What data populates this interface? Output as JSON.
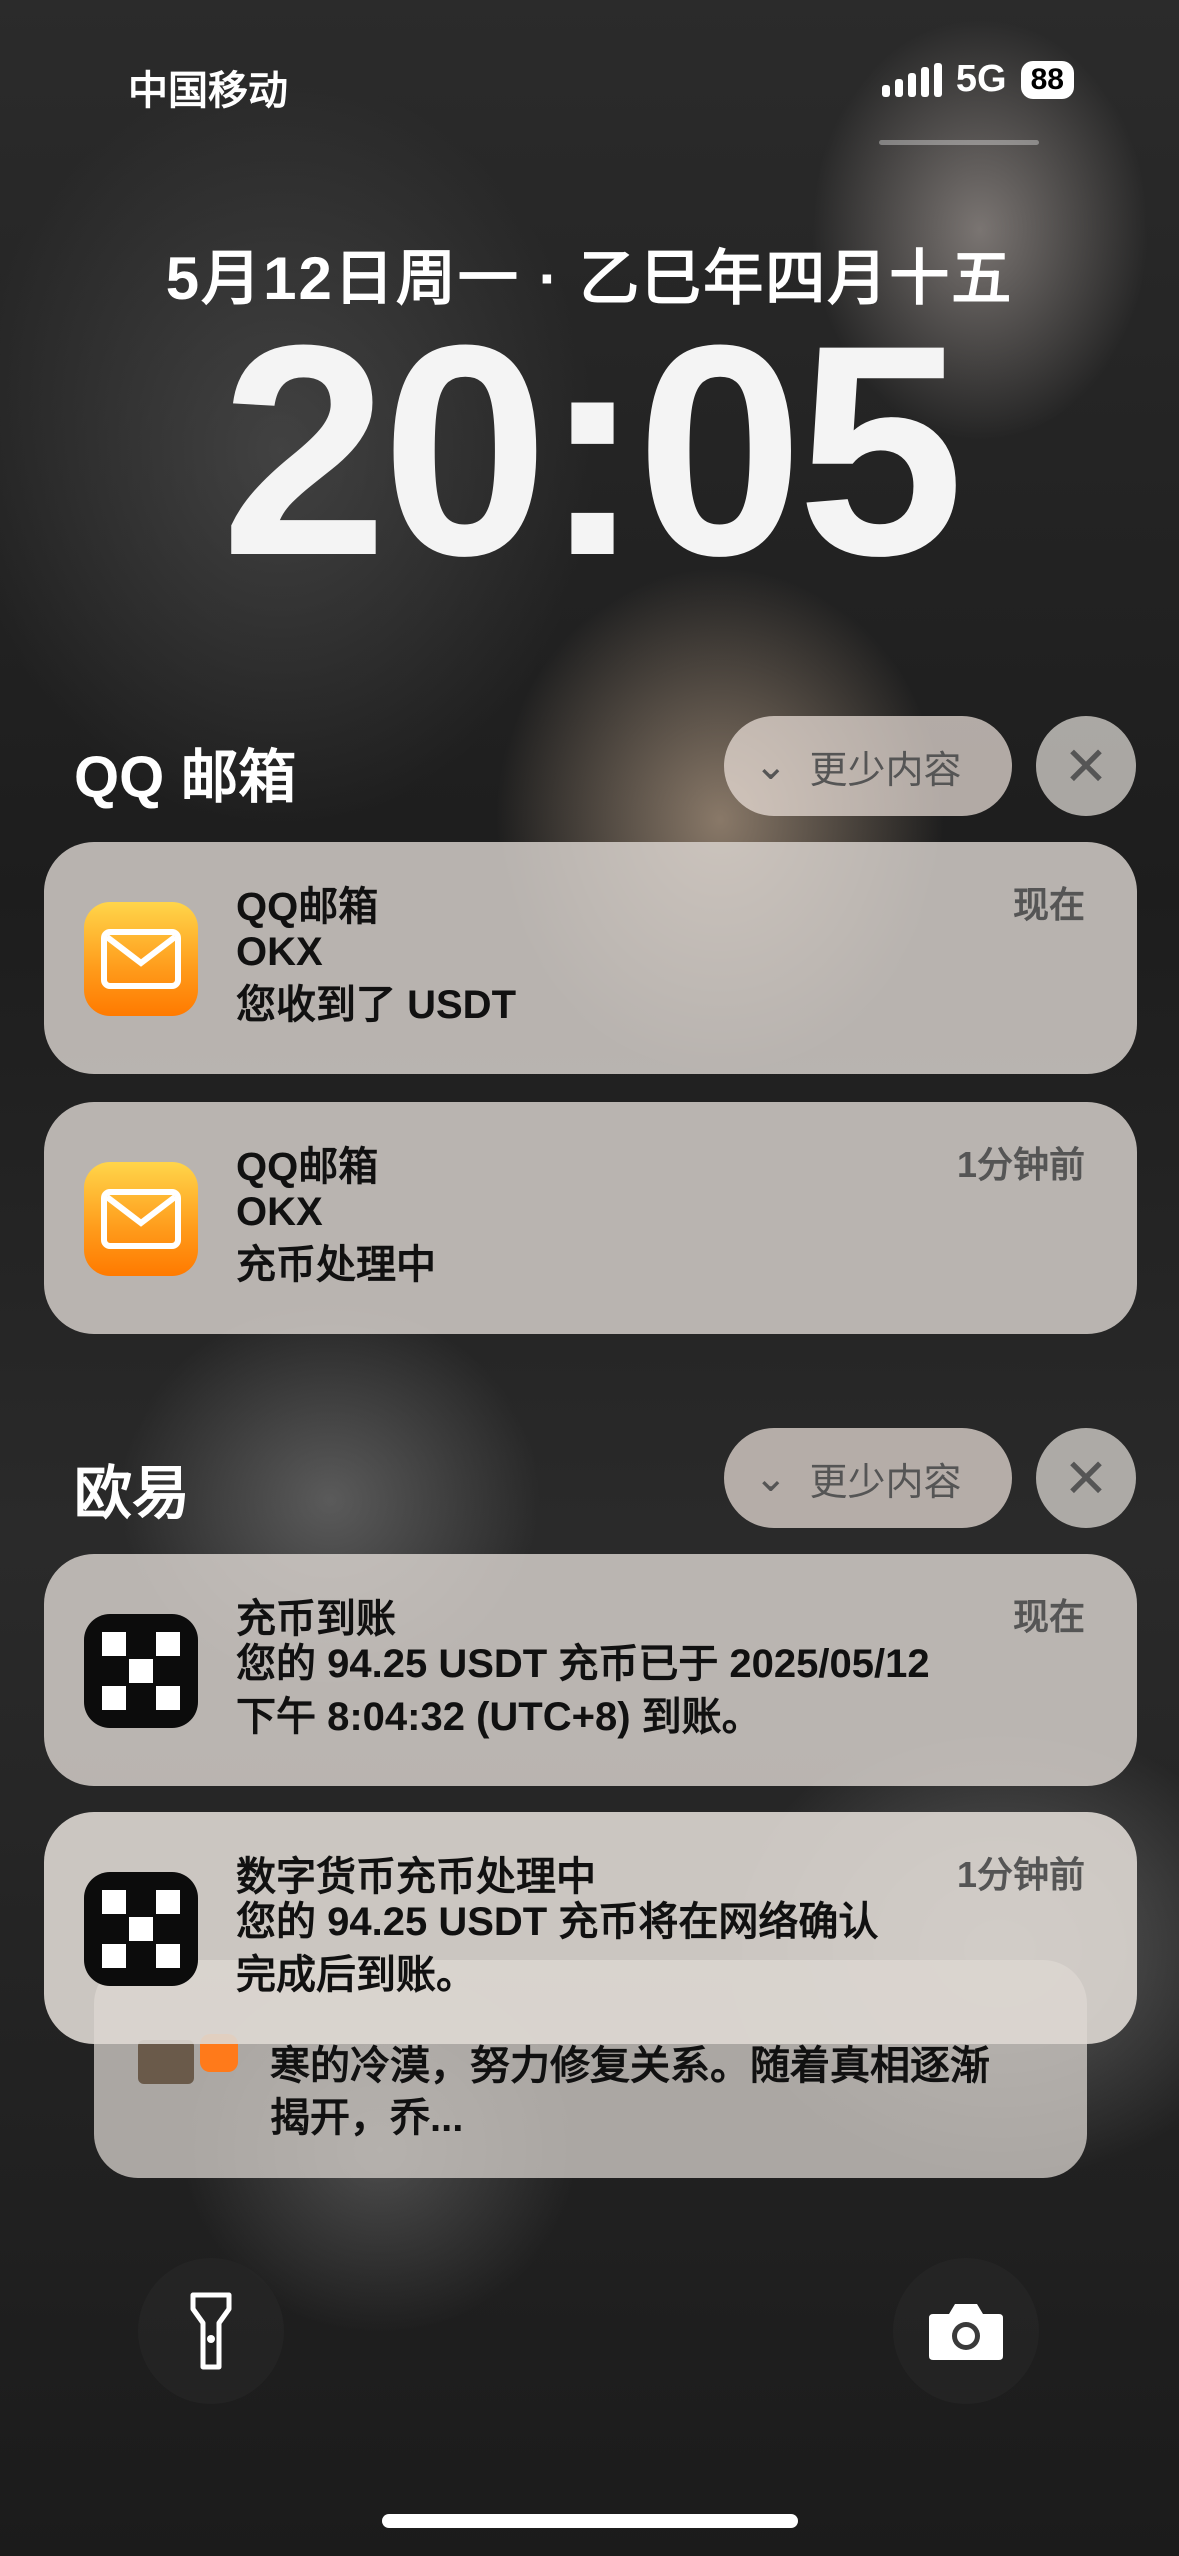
{
  "status_bar": {
    "carrier": "中国移动",
    "network": "5G",
    "battery": "88"
  },
  "lock_screen": {
    "date": "5月12日周一 · 乙巳年四月十五",
    "time": "20:05"
  },
  "groups": [
    {
      "app": "QQ 邮箱",
      "collapse_label": "更少内容",
      "notifications": [
        {
          "title": "QQ邮箱",
          "time": "现在",
          "line1": "OKX",
          "line2": "您收到了 USDT"
        },
        {
          "title": "QQ邮箱",
          "time": "1分钟前",
          "line1": "OKX",
          "line2": "充币处理中"
        }
      ]
    },
    {
      "app": "欧易",
      "collapse_label": "更少内容",
      "notifications": [
        {
          "title": "充币到账",
          "time": "现在",
          "line1": "您的 94.25 USDT 充币已于 2025/05/12",
          "line2": "下午 8:04:32 (UTC+8) 到账。"
        },
        {
          "title": "数字货币充币处理中",
          "time": "1分钟前",
          "line1": "您的 94.25 USDT 充币将在网络确认",
          "line2": "完成后到账。"
        }
      ]
    }
  ],
  "stacked_notification": {
    "line1": "寒的冷漠，努力修复关系。随着真相逐渐",
    "line2": "揭开，乔..."
  },
  "icons": {
    "flashlight": "flashlight-icon",
    "camera": "camera-icon",
    "mail": "mail-icon",
    "okx": "okx-logo-icon",
    "close": "close-icon",
    "chevron": "chevron-down-icon"
  }
}
